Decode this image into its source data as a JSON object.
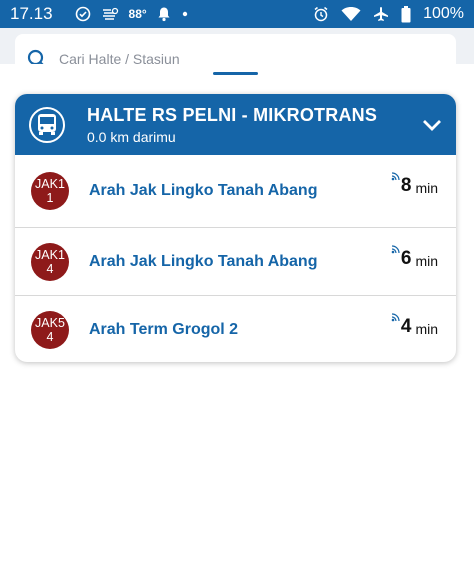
{
  "status_bar": {
    "time": "17.13",
    "temperature": "88°",
    "battery": "100%",
    "icons": [
      "check-circle-icon",
      "sensor-icon",
      "notification-bell-icon",
      "dot-icon",
      "alarm-icon",
      "wifi-icon",
      "airplane-icon",
      "battery-icon"
    ]
  },
  "search": {
    "placeholder": "Cari Halte / Stasiun",
    "icon": "search-icon"
  },
  "stop": {
    "name": "HALTE RS PELNI - MIKROTRANS",
    "distance": "0.0 km darimu",
    "icon": "bus-icon",
    "header_color": "#1565a8"
  },
  "routes": [
    {
      "code_line1": "JAK1",
      "code_line2": "1",
      "destination": "Arah Jak Lingko Tanah Abang",
      "eta_value": "8",
      "eta_unit": "min"
    },
    {
      "code_line1": "JAK1",
      "code_line2": "4",
      "destination": "Arah Jak Lingko Tanah Abang",
      "eta_value": "6",
      "eta_unit": "min"
    },
    {
      "code_line1": "JAK5",
      "code_line2": "4",
      "destination": "Arah Term Grogol 2",
      "eta_value": "4",
      "eta_unit": "min"
    }
  ],
  "colors": {
    "accent": "#1565a8",
    "badge": "#8e1a1a"
  }
}
